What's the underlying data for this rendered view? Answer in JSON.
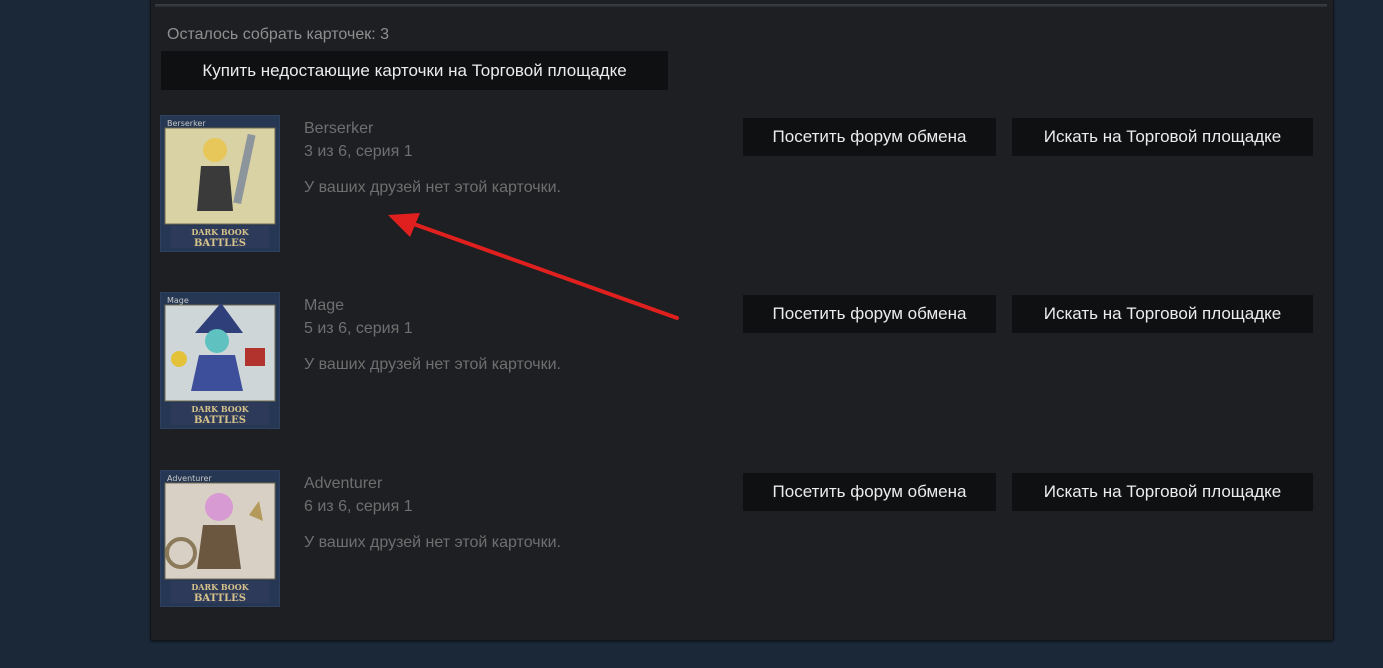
{
  "header": {
    "remaining_label": "Осталось собрать карточек: 3",
    "buy_missing_label": "Купить недостающие карточки на Торговой площадке"
  },
  "cards": [
    {
      "thumb_label": "Berserker",
      "name": "Berserker",
      "count": "3 из 6, серия 1",
      "friends": "У ваших друзей нет этой карточки.",
      "forum_label": "Посетить форум обмена",
      "market_label": "Искать на Торговой площадке",
      "logo_line1": "DARK BOOK",
      "logo_line2": "BATTLES",
      "accent": "#c9c36a"
    },
    {
      "thumb_label": "Mage",
      "name": "Mage",
      "count": "5 из 6, серия 1",
      "friends": "У ваших друзей нет этой карточки.",
      "forum_label": "Посетить форум обмена",
      "market_label": "Искать на Торговой площадке",
      "logo_line1": "DARK BOOK",
      "logo_line2": "BATTLES",
      "accent": "#3f7fa0"
    },
    {
      "thumb_label": "Adventurer",
      "name": "Adventurer",
      "count": "6 из 6, серия 1",
      "friends": "У ваших друзей нет этой карточки.",
      "forum_label": "Посетить форум обмена",
      "market_label": "Искать на Торговой площадке",
      "logo_line1": "DARK BOOK",
      "logo_line2": "BATTLES",
      "accent": "#b07ab0"
    }
  ],
  "colors": {
    "background": "#1b2838",
    "panel": "#1d1f22",
    "button": "#0f1012",
    "button_text": "#ececec",
    "muted_text": "#6f6f6f",
    "arrow": "#e0201e"
  }
}
